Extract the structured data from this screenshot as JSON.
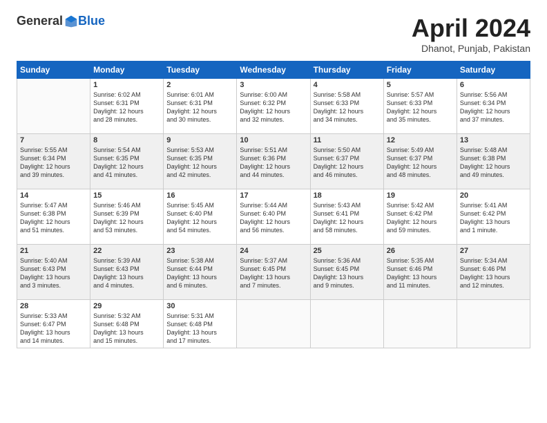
{
  "logo": {
    "general": "General",
    "blue": "Blue"
  },
  "title": "April 2024",
  "subtitle": "Dhanot, Punjab, Pakistan",
  "headers": [
    "Sunday",
    "Monday",
    "Tuesday",
    "Wednesday",
    "Thursday",
    "Friday",
    "Saturday"
  ],
  "weeks": [
    [
      {
        "day": "",
        "info": ""
      },
      {
        "day": "1",
        "info": "Sunrise: 6:02 AM\nSunset: 6:31 PM\nDaylight: 12 hours\nand 28 minutes."
      },
      {
        "day": "2",
        "info": "Sunrise: 6:01 AM\nSunset: 6:31 PM\nDaylight: 12 hours\nand 30 minutes."
      },
      {
        "day": "3",
        "info": "Sunrise: 6:00 AM\nSunset: 6:32 PM\nDaylight: 12 hours\nand 32 minutes."
      },
      {
        "day": "4",
        "info": "Sunrise: 5:58 AM\nSunset: 6:33 PM\nDaylight: 12 hours\nand 34 minutes."
      },
      {
        "day": "5",
        "info": "Sunrise: 5:57 AM\nSunset: 6:33 PM\nDaylight: 12 hours\nand 35 minutes."
      },
      {
        "day": "6",
        "info": "Sunrise: 5:56 AM\nSunset: 6:34 PM\nDaylight: 12 hours\nand 37 minutes."
      }
    ],
    [
      {
        "day": "7",
        "info": "Sunrise: 5:55 AM\nSunset: 6:34 PM\nDaylight: 12 hours\nand 39 minutes."
      },
      {
        "day": "8",
        "info": "Sunrise: 5:54 AM\nSunset: 6:35 PM\nDaylight: 12 hours\nand 41 minutes."
      },
      {
        "day": "9",
        "info": "Sunrise: 5:53 AM\nSunset: 6:35 PM\nDaylight: 12 hours\nand 42 minutes."
      },
      {
        "day": "10",
        "info": "Sunrise: 5:51 AM\nSunset: 6:36 PM\nDaylight: 12 hours\nand 44 minutes."
      },
      {
        "day": "11",
        "info": "Sunrise: 5:50 AM\nSunset: 6:37 PM\nDaylight: 12 hours\nand 46 minutes."
      },
      {
        "day": "12",
        "info": "Sunrise: 5:49 AM\nSunset: 6:37 PM\nDaylight: 12 hours\nand 48 minutes."
      },
      {
        "day": "13",
        "info": "Sunrise: 5:48 AM\nSunset: 6:38 PM\nDaylight: 12 hours\nand 49 minutes."
      }
    ],
    [
      {
        "day": "14",
        "info": "Sunrise: 5:47 AM\nSunset: 6:38 PM\nDaylight: 12 hours\nand 51 minutes."
      },
      {
        "day": "15",
        "info": "Sunrise: 5:46 AM\nSunset: 6:39 PM\nDaylight: 12 hours\nand 53 minutes."
      },
      {
        "day": "16",
        "info": "Sunrise: 5:45 AM\nSunset: 6:40 PM\nDaylight: 12 hours\nand 54 minutes."
      },
      {
        "day": "17",
        "info": "Sunrise: 5:44 AM\nSunset: 6:40 PM\nDaylight: 12 hours\nand 56 minutes."
      },
      {
        "day": "18",
        "info": "Sunrise: 5:43 AM\nSunset: 6:41 PM\nDaylight: 12 hours\nand 58 minutes."
      },
      {
        "day": "19",
        "info": "Sunrise: 5:42 AM\nSunset: 6:42 PM\nDaylight: 12 hours\nand 59 minutes."
      },
      {
        "day": "20",
        "info": "Sunrise: 5:41 AM\nSunset: 6:42 PM\nDaylight: 13 hours\nand 1 minute."
      }
    ],
    [
      {
        "day": "21",
        "info": "Sunrise: 5:40 AM\nSunset: 6:43 PM\nDaylight: 13 hours\nand 3 minutes."
      },
      {
        "day": "22",
        "info": "Sunrise: 5:39 AM\nSunset: 6:43 PM\nDaylight: 13 hours\nand 4 minutes."
      },
      {
        "day": "23",
        "info": "Sunrise: 5:38 AM\nSunset: 6:44 PM\nDaylight: 13 hours\nand 6 minutes."
      },
      {
        "day": "24",
        "info": "Sunrise: 5:37 AM\nSunset: 6:45 PM\nDaylight: 13 hours\nand 7 minutes."
      },
      {
        "day": "25",
        "info": "Sunrise: 5:36 AM\nSunset: 6:45 PM\nDaylight: 13 hours\nand 9 minutes."
      },
      {
        "day": "26",
        "info": "Sunrise: 5:35 AM\nSunset: 6:46 PM\nDaylight: 13 hours\nand 11 minutes."
      },
      {
        "day": "27",
        "info": "Sunrise: 5:34 AM\nSunset: 6:46 PM\nDaylight: 13 hours\nand 12 minutes."
      }
    ],
    [
      {
        "day": "28",
        "info": "Sunrise: 5:33 AM\nSunset: 6:47 PM\nDaylight: 13 hours\nand 14 minutes."
      },
      {
        "day": "29",
        "info": "Sunrise: 5:32 AM\nSunset: 6:48 PM\nDaylight: 13 hours\nand 15 minutes."
      },
      {
        "day": "30",
        "info": "Sunrise: 5:31 AM\nSunset: 6:48 PM\nDaylight: 13 hours\nand 17 minutes."
      },
      {
        "day": "",
        "info": ""
      },
      {
        "day": "",
        "info": ""
      },
      {
        "day": "",
        "info": ""
      },
      {
        "day": "",
        "info": ""
      }
    ]
  ]
}
